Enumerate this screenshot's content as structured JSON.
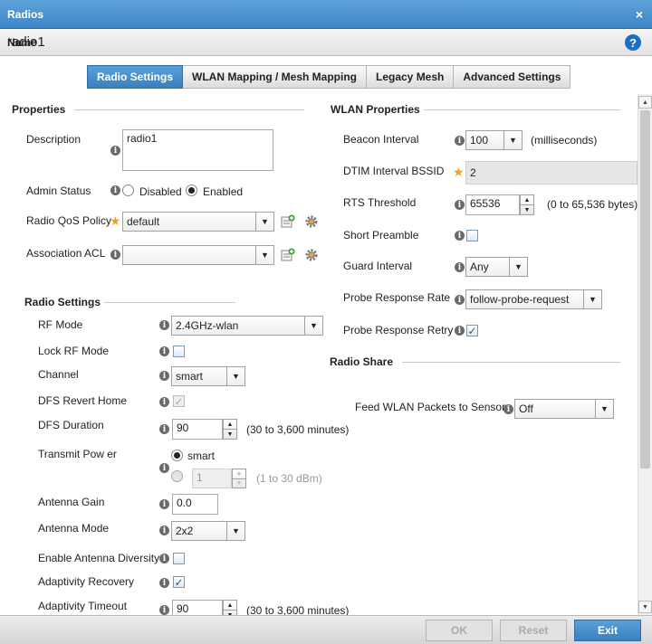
{
  "window": {
    "title": "Radios",
    "close": "×"
  },
  "name": {
    "label": "Name",
    "value": "radio1",
    "help": "?"
  },
  "tabs": [
    {
      "label": "Radio Settings",
      "active": true
    },
    {
      "label": "WLAN Mapping / Mesh Mapping"
    },
    {
      "label": "Legacy Mesh"
    },
    {
      "label": "Advanced Settings"
    }
  ],
  "properties": {
    "title": "Properties",
    "description": {
      "label": "Description",
      "value": "radio1"
    },
    "admin_status": {
      "label": "Admin Status",
      "options": [
        "Disabled",
        "Enabled"
      ],
      "selected": "Enabled"
    },
    "radio_qos_policy": {
      "label": "Radio QoS Policy",
      "value": "default"
    },
    "association_acl": {
      "label": "Association ACL",
      "value": ""
    }
  },
  "radio_settings": {
    "title": "Radio Settings",
    "rf_mode": {
      "label": "RF Mode",
      "value": "2.4GHz-wlan"
    },
    "lock_rf_mode": {
      "label": "Lock RF Mode",
      "checked": false
    },
    "channel": {
      "label": "Channel",
      "value": "smart"
    },
    "dfs_revert_home": {
      "label": "DFS Revert Home",
      "checked": true
    },
    "dfs_duration": {
      "label": "DFS Duration",
      "value": "90",
      "hint": "(30 to 3,600 minutes)"
    },
    "transmit_power": {
      "label": "Transmit Pow er",
      "option_smart": "smart",
      "value": "1",
      "hint": "(1 to 30 dBm)"
    },
    "antenna_gain": {
      "label": "Antenna Gain",
      "value": "0.0"
    },
    "antenna_mode": {
      "label": "Antenna Mode",
      "value": "2x2"
    },
    "enable_antenna_diversity": {
      "label": "Enable Antenna Diversity",
      "checked": false
    },
    "adaptivity_recovery": {
      "label": "Adaptivity Recovery",
      "checked": true
    },
    "adaptivity_timeout": {
      "label": "Adaptivity Timeout",
      "value": "90",
      "hint": "(30 to 3,600 minutes)"
    }
  },
  "wlan_properties": {
    "title": "WLAN Properties",
    "beacon_interval": {
      "label": "Beacon Interval",
      "value": "100",
      "hint": "(milliseconds)"
    },
    "dtim_interval_bssid": {
      "label": "DTIM Interval BSSID",
      "value": "2"
    },
    "rts_threshold": {
      "label": "RTS Threshold",
      "value": "65536",
      "hint": "(0 to 65,536 bytes)"
    },
    "short_preamble": {
      "label": "Short Preamble",
      "checked": false
    },
    "guard_interval": {
      "label": "Guard Interval",
      "value": "Any"
    },
    "probe_response_rate": {
      "label": "Probe Response Rate",
      "value": "follow-probe-request"
    },
    "probe_response_retry": {
      "label": "Probe Response Retry",
      "checked": true
    }
  },
  "radio_share": {
    "title": "Radio Share",
    "feed_wlan_packets": {
      "label": "Feed WLAN Packets to Sensor",
      "value": "Off"
    }
  },
  "footer": {
    "ok": "OK",
    "reset": "Reset",
    "exit": "Exit"
  },
  "glyphs": {
    "info": "i",
    "star": "★",
    "check": "✓",
    "dropdown": "▼",
    "up": "▲",
    "down": "▼"
  }
}
